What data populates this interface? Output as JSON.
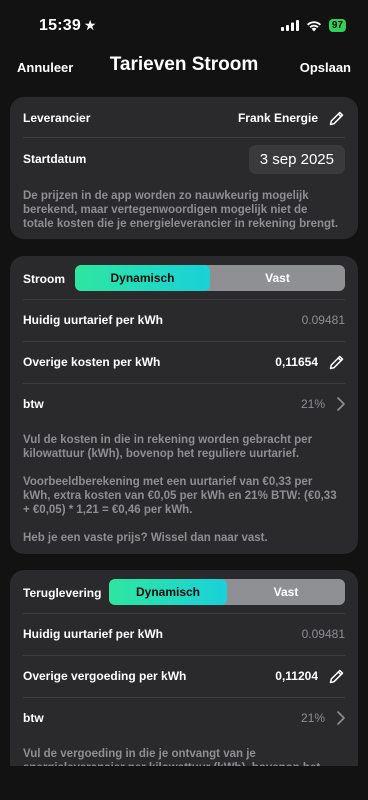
{
  "status": {
    "time": "15:39",
    "battery": "97"
  },
  "nav": {
    "cancel": "Annuleer",
    "title": "Tarieven Stroom",
    "save": "Opslaan"
  },
  "supplier": {
    "label": "Leverancier",
    "value": "Frank Energie",
    "start_label": "Startdatum",
    "start_value": "3 sep 2025",
    "note": "De prijzen in de app worden zo nauwkeurig mogelijk berekend, maar vertegenwoordigen mogelijk niet de totale kosten die je energieleverancier in rekening brengt."
  },
  "stroom": {
    "label": "Stroom",
    "seg_dynamic": "Dynamisch",
    "seg_fixed": "Vast",
    "rate_label": "Huidig uurtarief per kWh",
    "rate_value": "0.09481",
    "other_label": "Overige kosten per kWh",
    "other_value": "0,11654",
    "vat_label": "btw",
    "vat_value": "21%",
    "note1": "Vul de kosten in die in rekening worden gebracht per kilowattuur (kWh), bovenop het reguliere uurtarief.",
    "note2": "Voorbeeldberekening met een uurtarief van €0,33 per kWh, extra kosten van €0,05 per kWh en 21% BTW: (€0,33 + €0,05) * 1,21 = €0,46 per kWh.",
    "note3": "Heb je een vaste prijs? Wissel dan naar vast."
  },
  "teruglevering": {
    "label": "Teruglevering",
    "seg_dynamic": "Dynamisch",
    "seg_fixed": "Vast",
    "rate_label": "Huidig uurtarief per kWh",
    "rate_value": "0.09481",
    "other_label": "Overige vergoeding per kWh",
    "other_value": "0,11204",
    "vat_label": "btw",
    "vat_value": "21%",
    "note1": "Vul de vergoeding in die je ontvangt van je energieleverancier per kilowattuur (kWh), bovenop het"
  },
  "colors": {
    "accent_start": "#2ee6a0",
    "accent_end": "#19d1d9",
    "card": "#2a2a2c",
    "background": "#121212"
  }
}
